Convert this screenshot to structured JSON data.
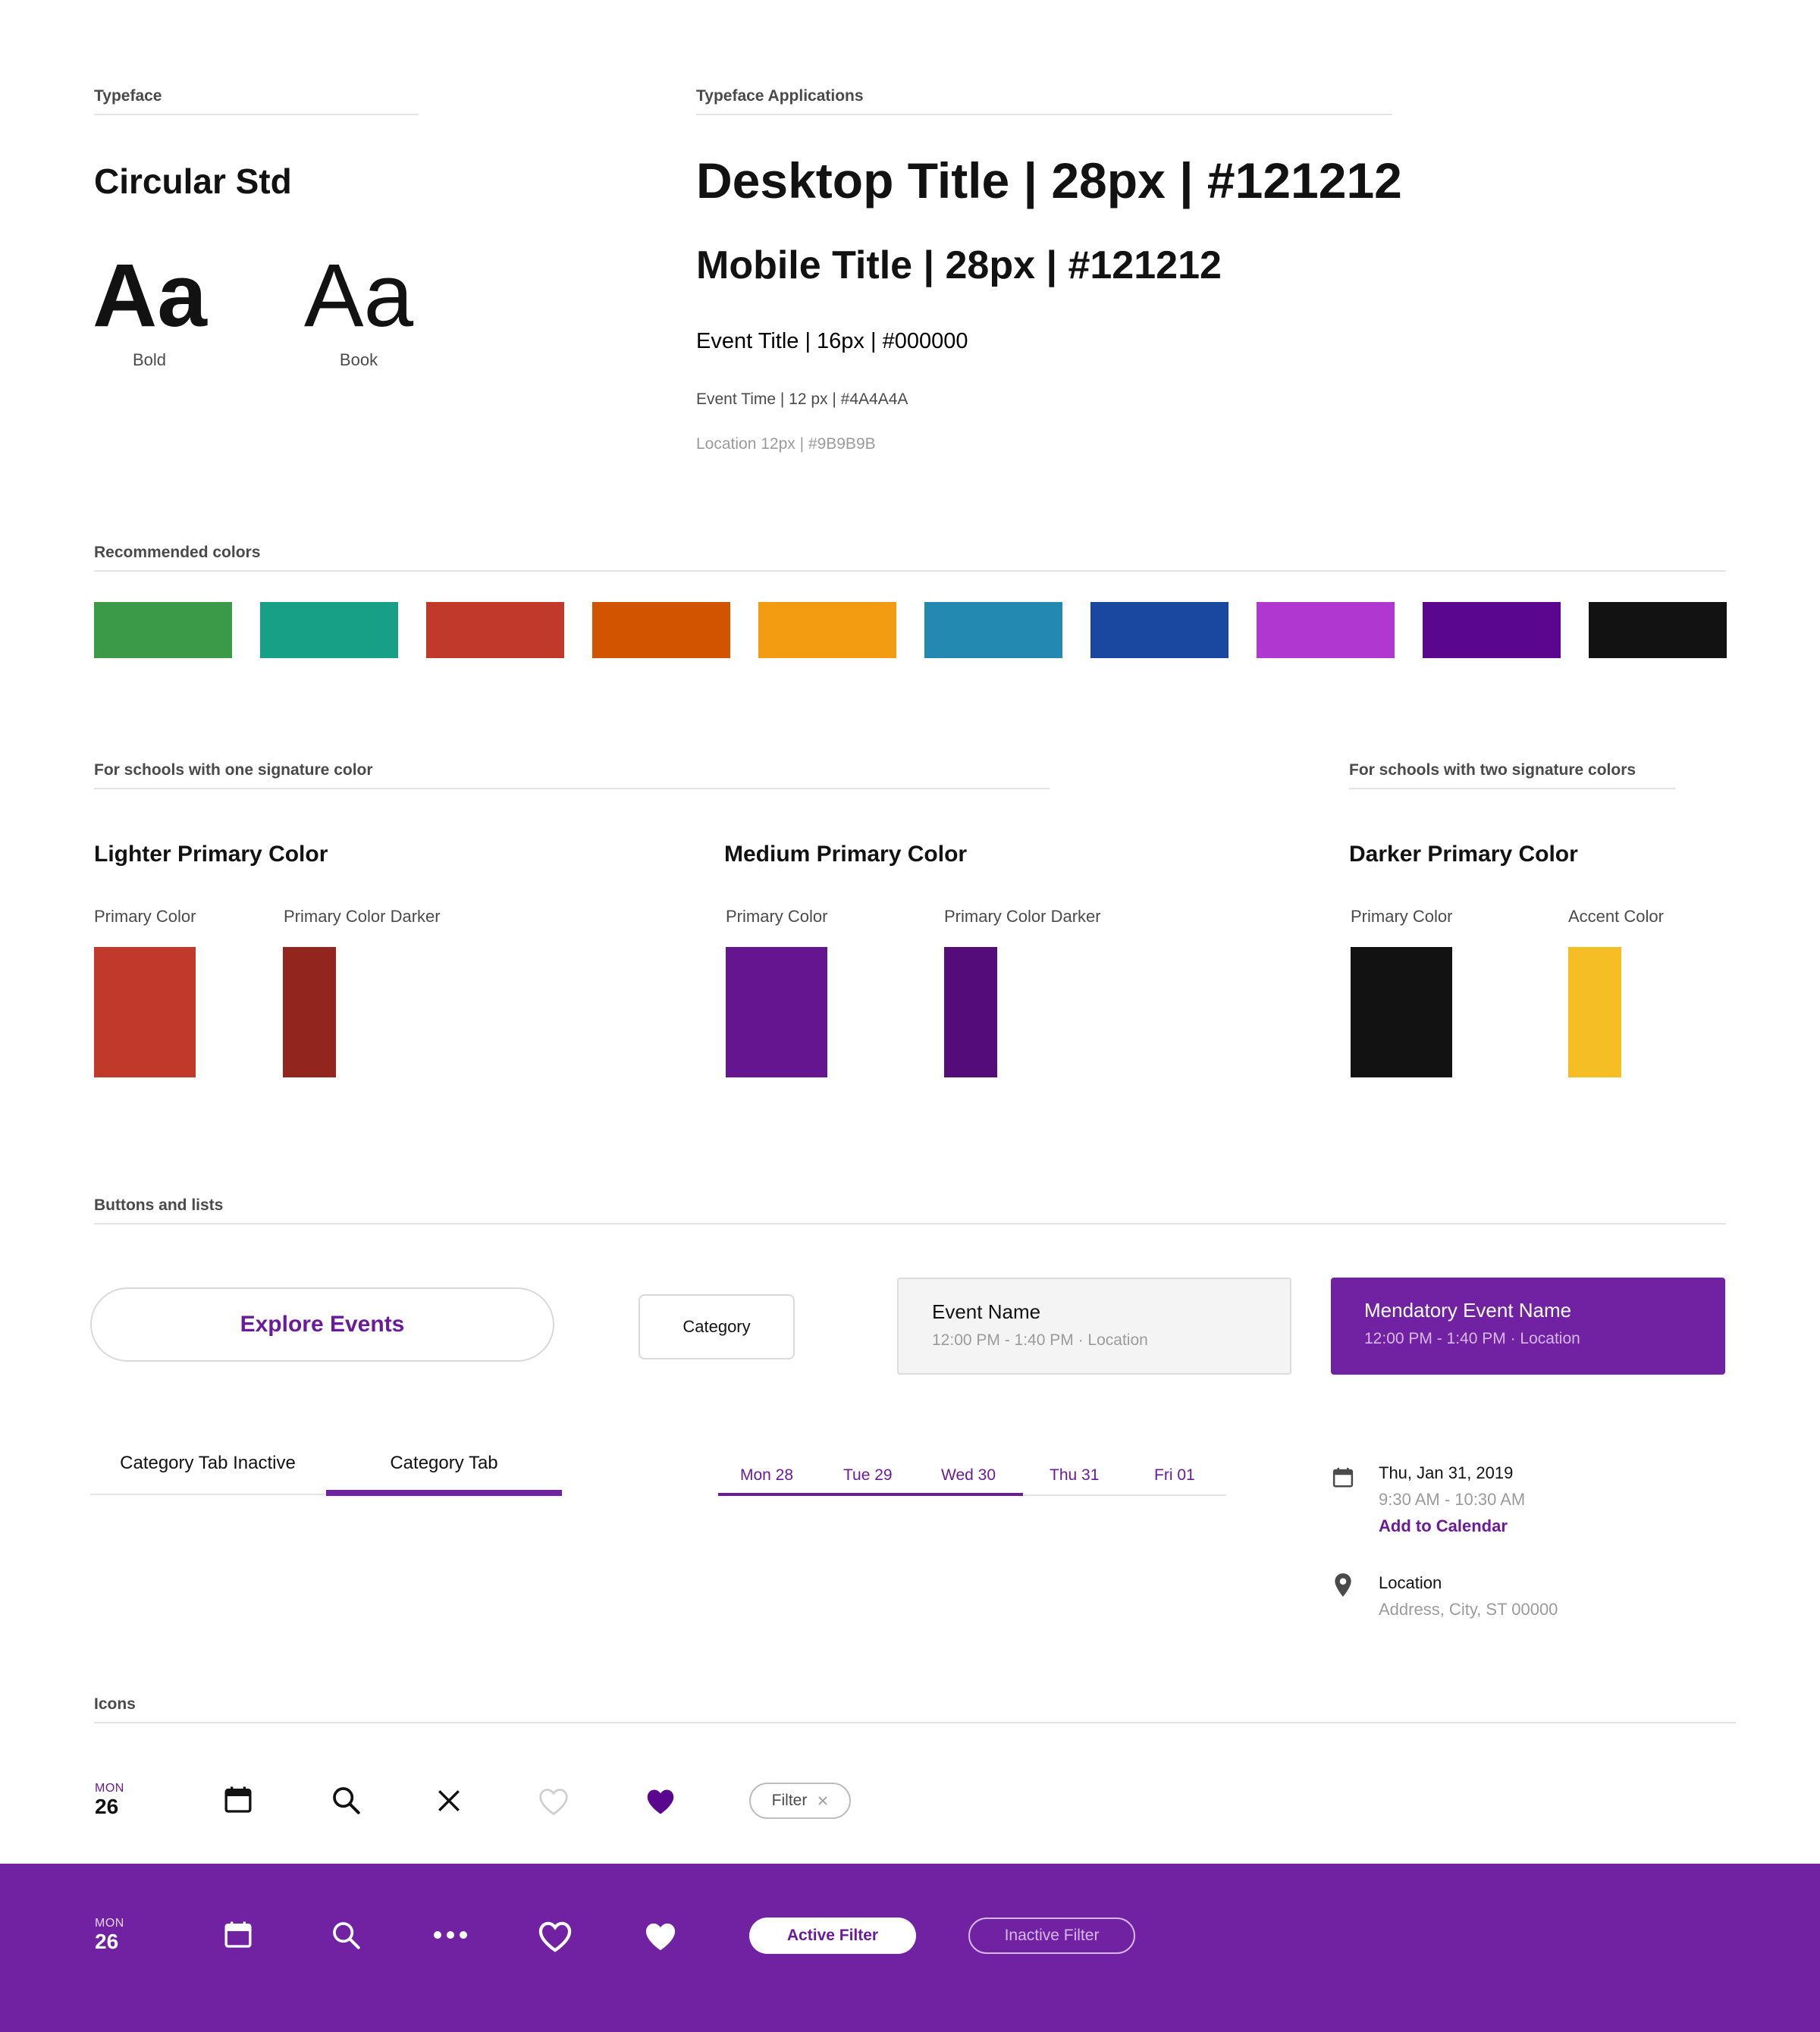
{
  "typeface": {
    "section_label": "Typeface",
    "font_name": "Circular Std",
    "sample_text": "Aa",
    "weights": [
      "Bold",
      "Book"
    ]
  },
  "applications": {
    "section_label": "Typeface Applications",
    "desktop_title": "Desktop Title | 28px | #121212",
    "mobile_title": "Mobile Title | 28px | #121212",
    "event_title": "Event Title | 16px | #000000",
    "event_time": "Event Time | 12 px | #4A4A4A",
    "location": "Location 12px | #9B9B9B"
  },
  "recommended": {
    "section_label": "Recommended colors",
    "colors": [
      "#3A9A48",
      "#17A086",
      "#C0392B",
      "#D35400",
      "#F39C12",
      "#2389B1",
      "#1A47A0",
      "#B137D1",
      "#5B068F",
      "#121212"
    ]
  },
  "schools": {
    "one_label": "For schools with one signature color",
    "two_label": "For schools with two signature colors",
    "groups": [
      {
        "title": "Lighter Primary Color",
        "swatches": [
          {
            "label": "Primary Color",
            "color": "#C0392B"
          },
          {
            "label": "Primary Color Darker",
            "color": "#92261F"
          }
        ]
      },
      {
        "title": "Medium Primary Color",
        "swatches": [
          {
            "label": "Primary Color",
            "color": "#65158F"
          },
          {
            "label": "Primary Color Darker",
            "color": "#530C7A"
          }
        ]
      },
      {
        "title": "Darker Primary Color",
        "swatches": [
          {
            "label": "Primary Color",
            "color": "#121212"
          },
          {
            "label": "Accent Color",
            "color": "#F4BE24"
          }
        ]
      }
    ]
  },
  "buttons": {
    "section_label": "Buttons and lists",
    "explore": "Explore Events",
    "category": "Category",
    "event_card": {
      "name": "Event Name",
      "meta": "12:00 PM - 1:40 PM · Location"
    },
    "mandatory_card": {
      "name": "Mendatory Event Name",
      "meta": "12:00 PM - 1:40 PM · Location"
    },
    "tabs": [
      "Category Tab Inactive",
      "Category Tab"
    ],
    "days": [
      "Mon 28",
      "Tue 29",
      "Wed 30",
      "Thu 31",
      "Fri 01"
    ],
    "detail": {
      "date": "Thu, Jan 31, 2019",
      "time": "9:30 AM - 10:30 AM",
      "add_calendar": "Add to Calendar",
      "location_title": "Location",
      "address": "Address, City, ST 00000"
    }
  },
  "icons": {
    "section_label": "Icons",
    "date_dow": "MON",
    "date_num": "26",
    "filter_label": "Filter",
    "names": [
      "calendar-icon",
      "search-icon",
      "close-icon",
      "heart-outline-icon",
      "heart-filled-icon"
    ]
  },
  "footer": {
    "date_dow": "MON",
    "date_num": "26",
    "active_filter": "Active Filter",
    "inactive_filter": "Inactive Filter",
    "names": [
      "calendar-icon",
      "search-icon",
      "more-icon",
      "heart-outline-icon",
      "heart-filled-icon"
    ]
  },
  "accent_color": "#6A1B9A",
  "footer_color": "#7022A3"
}
